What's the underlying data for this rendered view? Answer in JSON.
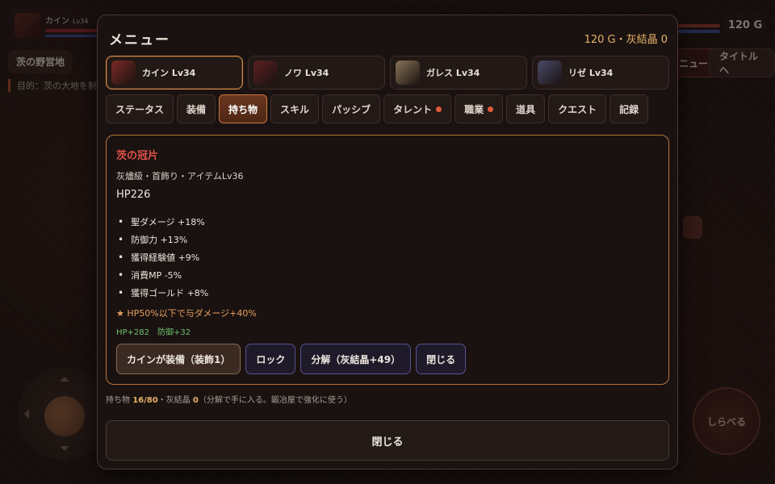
{
  "hud": {
    "player_name": "カイン",
    "player_level": "Lv34",
    "gold_display": "120 G",
    "location": "茨の野営地",
    "objective": "目的：茨の大地を制",
    "menu_chip": "ニュー",
    "title_chip": "タイトルへ",
    "search_button": "しらべる"
  },
  "modal": {
    "title": "メニュー",
    "currency": "120 G・灰結晶 0",
    "characters": [
      {
        "name": "カイン Lv34",
        "active": true,
        "color": "#7a2a24"
      },
      {
        "name": "ノワ Lv34",
        "active": false,
        "color": "#5a2222"
      },
      {
        "name": "ガレス Lv34",
        "active": false,
        "color": "#8a7458"
      },
      {
        "name": "リゼ Lv34",
        "active": false,
        "color": "#4a4a6a"
      }
    ],
    "tabs": [
      {
        "label": "ステータス",
        "active": false,
        "dot": false
      },
      {
        "label": "装備",
        "active": false,
        "dot": false
      },
      {
        "label": "持ち物",
        "active": true,
        "dot": false
      },
      {
        "label": "スキル",
        "active": false,
        "dot": false
      },
      {
        "label": "パッシブ",
        "active": false,
        "dot": false
      },
      {
        "label": "タレント",
        "active": false,
        "dot": true
      },
      {
        "label": "職業",
        "active": false,
        "dot": true
      },
      {
        "label": "道具",
        "active": false,
        "dot": false
      },
      {
        "label": "クエスト",
        "active": false,
        "dot": false
      },
      {
        "label": "記録",
        "active": false,
        "dot": false
      }
    ],
    "item": {
      "name": "茨の冠片",
      "type": "灰燼級・首飾り・アイテムLv36",
      "hp": "HP226",
      "stats": [
        "聖ダメージ +18%",
        "防御力 +13%",
        "獲得経験値 +9%",
        "消費MP -5%",
        "獲得ゴールド +8%"
      ],
      "special": "★ HP50%以下で与ダメージ+40%",
      "bonus": "HP+282　防御+32",
      "actions": {
        "equip": "カインが装備（装飾1）",
        "lock": "ロック",
        "dismantle": "分解（灰結晶+49）",
        "close": "閉じる"
      }
    },
    "footer": {
      "prefix": "持ち物 ",
      "count": "16/80",
      "middle": "・灰結晶 ",
      "crystal": "0",
      "suffix": "（分解で手に入る。鍛冶屋で強化に使う）"
    },
    "close_button": "閉じる"
  },
  "colors": {
    "accent": "#d48a4a",
    "item_name": "#e0524a",
    "special": "#e6a060",
    "bonus": "#6cc070",
    "currency": "#e6b26a",
    "notification_dot": "#e05a3a"
  }
}
